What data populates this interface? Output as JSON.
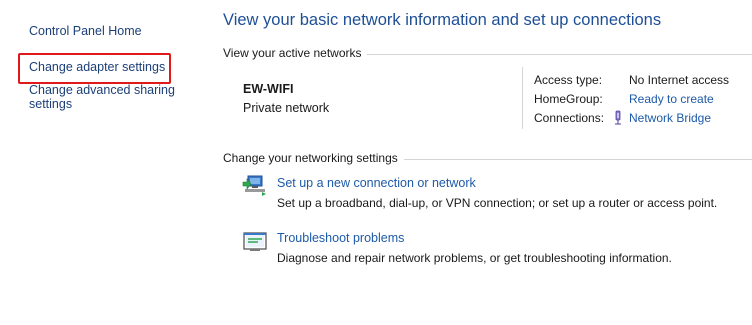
{
  "sidebar": {
    "home_label": "Control Panel Home",
    "adapter_label": "Change adapter settings",
    "advanced_label": "Change advanced sharing settings"
  },
  "main": {
    "title": "View your basic network information and set up connections",
    "active_networks_header": "View your active networks",
    "network": {
      "name": "EW-WIFI",
      "type": "Private network",
      "access_type_label": "Access type:",
      "access_type_value": "No Internet access",
      "homegroup_label": "HomeGroup:",
      "homegroup_value": "Ready to create",
      "connections_label": "Connections:",
      "connections_value": "Network Bridge",
      "connections_icon": "network-bridge-icon"
    },
    "change_settings_header": "Change your networking settings",
    "tasks": [
      {
        "link": "Set up a new connection or network",
        "description": "Set up a broadband, dial-up, or VPN connection; or set up a router or access point.",
        "icon": "new-connection-icon"
      },
      {
        "link": "Troubleshoot problems",
        "description": "Diagnose and repair network problems, or get troubleshooting information.",
        "icon": "troubleshoot-icon"
      }
    ]
  },
  "colors": {
    "link": "#1e5aa8",
    "title": "#1e4f96",
    "highlight": "#e01a1a",
    "divider": "#d5d5d5"
  }
}
